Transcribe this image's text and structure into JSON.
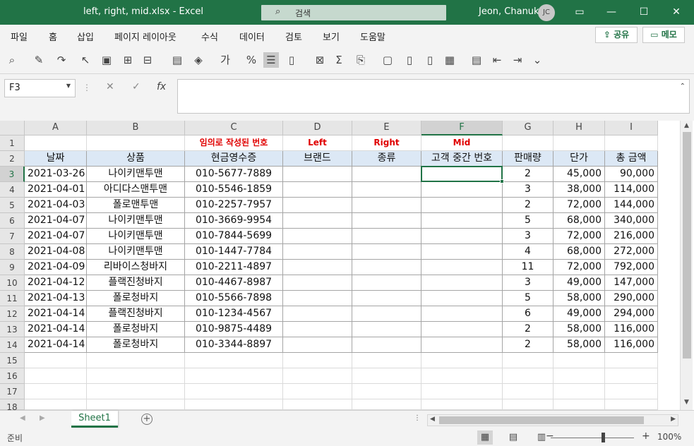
{
  "window": {
    "title": "left, right, mid.xlsx  -  Excel",
    "search_placeholder": "검색",
    "user": "Jeon, Chanuk",
    "avatar": "JC"
  },
  "menu": {
    "items": [
      "파일",
      "홈",
      "삽입",
      "페이지 레이아웃",
      "수식",
      "데이터",
      "검토",
      "보기",
      "도움말"
    ],
    "share": "공유",
    "memo": "메모"
  },
  "formula": {
    "namebox": "F3",
    "fx": "fx",
    "content": ""
  },
  "grid": {
    "columns": [
      "A",
      "B",
      "C",
      "D",
      "E",
      "F",
      "G",
      "H",
      "I"
    ],
    "rows": [
      "1",
      "2",
      "3",
      "4",
      "5",
      "6",
      "7",
      "8",
      "9",
      "10",
      "11",
      "12",
      "13",
      "14",
      "15",
      "16",
      "17",
      "18"
    ],
    "notes": {
      "C": "임의로 작성된 번호",
      "D": "Left",
      "E": "Right",
      "F": "Mid"
    },
    "headers": [
      "날짜",
      "상품",
      "현금영수증",
      "브랜드",
      "종류",
      "고객 중간 번호",
      "판매량",
      "단가",
      "총 금액"
    ],
    "data": [
      [
        "2021-03-26",
        "나이키맨투맨",
        "010-5677-7889",
        "",
        "",
        "",
        "2",
        "45,000",
        "90,000"
      ],
      [
        "2021-04-01",
        "아디다스맨투맨",
        "010-5546-1859",
        "",
        "",
        "",
        "3",
        "38,000",
        "114,000"
      ],
      [
        "2021-04-03",
        "폴로맨투맨",
        "010-2257-7957",
        "",
        "",
        "",
        "2",
        "72,000",
        "144,000"
      ],
      [
        "2021-04-07",
        "나이키맨투맨",
        "010-3669-9954",
        "",
        "",
        "",
        "5",
        "68,000",
        "340,000"
      ],
      [
        "2021-04-07",
        "나이키맨투맨",
        "010-7844-5699",
        "",
        "",
        "",
        "3",
        "72,000",
        "216,000"
      ],
      [
        "2021-04-08",
        "나이키맨투맨",
        "010-1447-7784",
        "",
        "",
        "",
        "4",
        "68,000",
        "272,000"
      ],
      [
        "2021-04-09",
        "리바이스청바지",
        "010-2211-4897",
        "",
        "",
        "",
        "11",
        "72,000",
        "792,000"
      ],
      [
        "2021-04-12",
        "플랙진청바지",
        "010-4467-8987",
        "",
        "",
        "",
        "3",
        "49,000",
        "147,000"
      ],
      [
        "2021-04-13",
        "폴로청바지",
        "010-5566-7898",
        "",
        "",
        "",
        "5",
        "58,000",
        "290,000"
      ],
      [
        "2021-04-14",
        "플랙진청바지",
        "010-1234-4567",
        "",
        "",
        "",
        "6",
        "49,000",
        "294,000"
      ],
      [
        "2021-04-14",
        "폴로청바지",
        "010-9875-4489",
        "",
        "",
        "",
        "2",
        "58,000",
        "116,000"
      ],
      [
        "2021-04-14",
        "폴로청바지",
        "010-3344-8897",
        "",
        "",
        "",
        "2",
        "58,000",
        "116,000"
      ]
    ],
    "selected_cell": "F3"
  },
  "tabs": {
    "sheets": [
      "Sheet1"
    ],
    "add": "+"
  },
  "status": {
    "ready": "준비",
    "zoom": "100%"
  },
  "colors": {
    "accent": "#217346",
    "note_red": "#e00000",
    "header_fill": "#dce8f5"
  }
}
